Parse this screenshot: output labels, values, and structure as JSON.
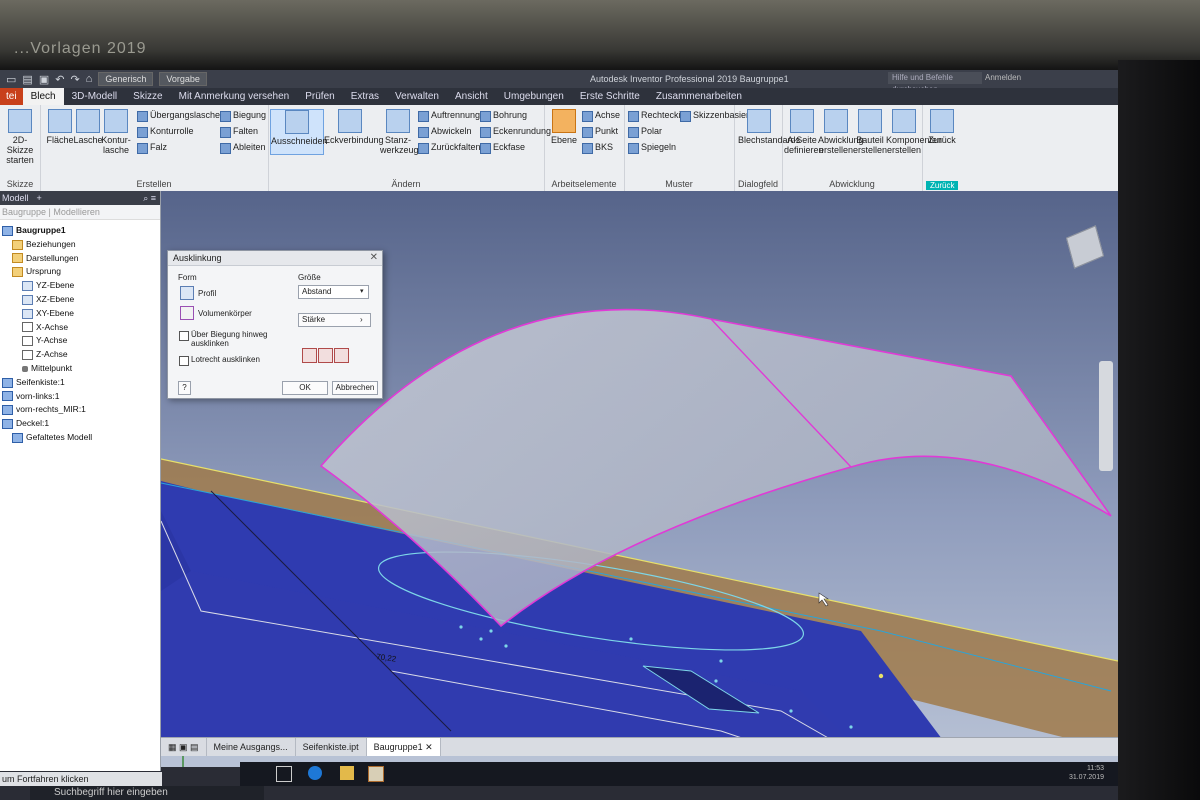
{
  "window": {
    "bg_title": "...Vorlagen 2019",
    "app_title": "Autodesk Inventor Professional 2019   Baugruppe1",
    "quick_select_1": "Generisch",
    "quick_select_2": "Vorgabe",
    "search_placeholder": "Hilfe und Befehle durchsuchen...",
    "user": "Anmelden"
  },
  "tabs": [
    "tei",
    "Blech",
    "3D-Modell",
    "Skizze",
    "Mit Anmerkung versehen",
    "Prüfen",
    "Extras",
    "Verwalten",
    "Ansicht",
    "Umgebungen",
    "Erste Schritte",
    "Zusammenarbeiten"
  ],
  "ribbon": {
    "skizze": {
      "btn": "2D-Skizze starten",
      "label": "Skizze"
    },
    "erstellen": {
      "label": "Erstellen",
      "flaeche": "Fläche",
      "lasche": "Lasche",
      "konturlasche": "Kontur-lasche",
      "uebergangslasche": "Übergangslasche",
      "konturrolle": "Konturrolle",
      "falz": "Falz",
      "biegung": "Biegung",
      "falten": "Falten",
      "ableiten": "Ableiten"
    },
    "aendern": {
      "label": "Ändern",
      "ausschneiden": "Ausschneiden",
      "eckverbindung": "Eckverbindung",
      "stanzwerkzeug": "Stanz-werkzeug",
      "auftrennung": "Auftrennung",
      "abwickeln": "Abwickeln",
      "zurueckfalten": "Zurückfalten",
      "bohrung": "Bohrung",
      "eckenrundung": "Eckenrundung",
      "eckfase": "Eckfase"
    },
    "arbeitselemente": {
      "label": "Arbeitselemente",
      "ebene": "Ebene",
      "achse": "Achse",
      "punkt": "Punkt",
      "bks": "BKS"
    },
    "muster": {
      "label": "Muster",
      "rechteckig": "Rechteckig",
      "polar": "Polar",
      "spiegeln": "Spiegeln",
      "skizzenbasiert": "Skizzenbasiert"
    },
    "dialogfeld": {
      "label": "Dialogfeld",
      "blechstandards": "Blechstandards"
    },
    "abwicklung": {
      "label": "Abwicklung",
      "a_seite": "A-Seite definieren",
      "abwicklung_erstellen": "Abwicklung erstellen",
      "bauteil_erstellen": "Bauteil erstellen",
      "komponenten_erstellen": "Komponenten erstellen"
    },
    "zurueck": {
      "label": "Zurück",
      "btn": "Zurück"
    }
  },
  "browser": {
    "tab1": "Modell",
    "sub1": "Baugruppe",
    "sub2": "Modellieren",
    "nodes": [
      "Baugruppe1",
      "Beziehungen",
      "Darstellungen",
      "Ursprung",
      "YZ-Ebene",
      "XZ-Ebene",
      "XY-Ebene",
      "X-Achse",
      "Y-Achse",
      "Z-Achse",
      "Mittelpunkt",
      "Seifenkiste:1",
      "vorn-links:1",
      "vorn-rechts_MIR:1",
      "Deckel:1",
      "Gefaltetes Modell"
    ]
  },
  "dialog": {
    "title": "Ausklinkung",
    "form": "Form",
    "profil": "Profil",
    "volumenkoerper": "Volumenkörper",
    "groesse": "Größe",
    "abstand": "Abstand",
    "staerke": "Stärke",
    "ueber_biegung": "Über Biegung hinweg ausklinken",
    "lotrecht": "Lotrecht ausklinken",
    "ok": "OK",
    "abbrechen": "Abbrechen",
    "help": "?"
  },
  "viewport": {
    "dimension": "70,22"
  },
  "doc_tabs": [
    "Meine Ausgangs...",
    "Seifenkiste.ipt",
    "Baugruppe1"
  ],
  "status_text": "um Fortfahren klicken",
  "taskbar": {
    "search": "Suchbegriff hier eingeben",
    "time": "11:53",
    "date": "31.07.2019"
  },
  "colors": {
    "ribbon_active": "#cfe3fb",
    "file_tab": "#c8401b",
    "surface_edge": "#e03ad6",
    "sheet_blue": "#2f3bb0"
  }
}
